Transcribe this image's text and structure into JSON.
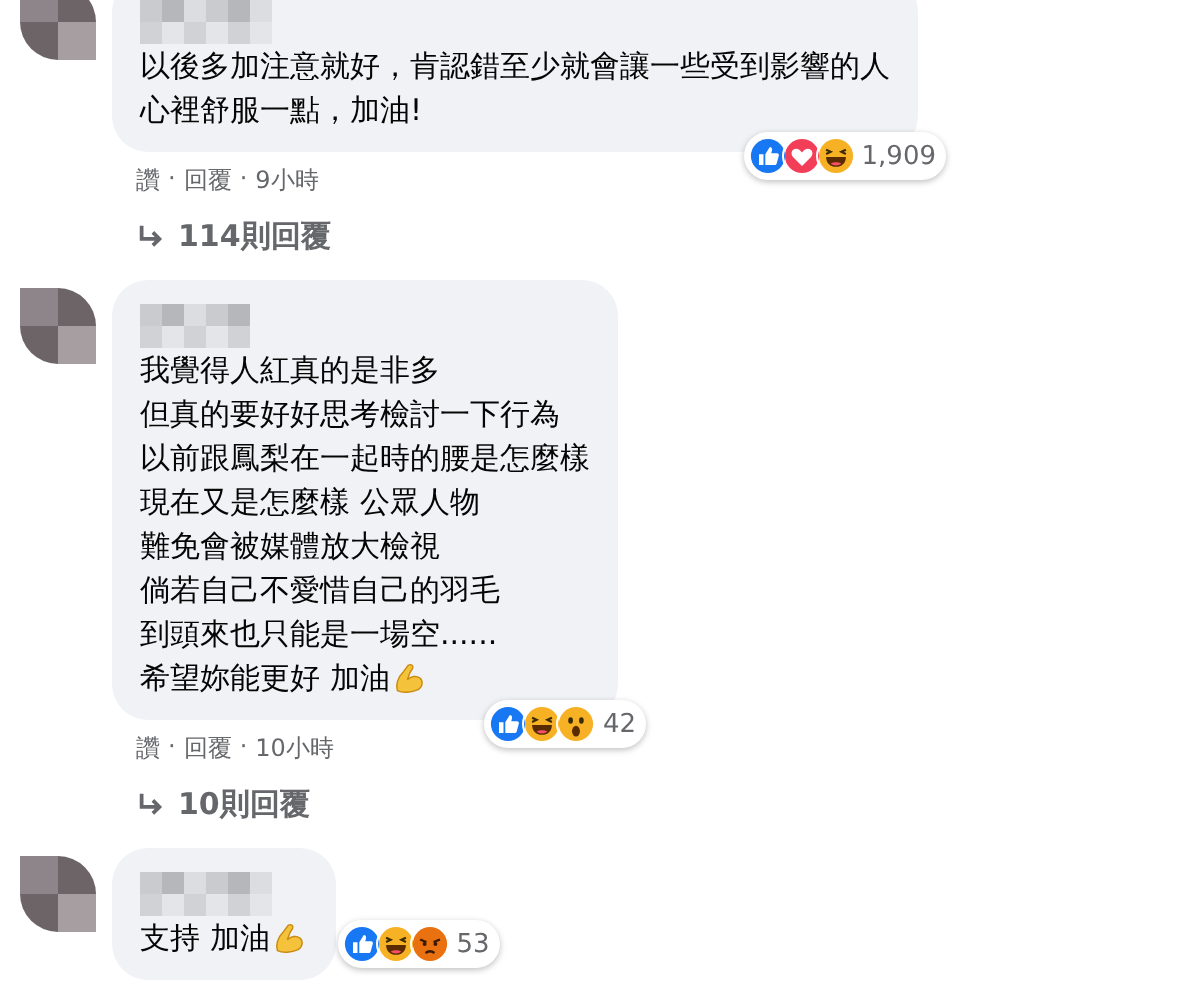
{
  "comments": [
    {
      "lines": [
        "以後多加注意就好，肯認錯至少就會讓一些受到影響的人",
        "心裡舒服一點，加油!"
      ],
      "flex_emoji": false,
      "reactions": [
        {
          "kind": "like"
        },
        {
          "kind": "love"
        },
        {
          "kind": "haha"
        }
      ],
      "reaction_count": "1,909",
      "actions": [
        "讚",
        "回覆",
        "9小時"
      ],
      "replies": "114則回覆"
    },
    {
      "lines": [
        "我覺得人紅真的是非多",
        "但真的要好好思考檢討一下行為",
        "以前跟鳳梨在一起時的腰是怎麼樣",
        "現在又是怎麼樣 公眾人物",
        "難免會被媒體放大檢視",
        "倘若自己不愛惜自己的羽毛",
        "到頭來也只能是一場空......",
        "希望妳能更好 加油"
      ],
      "flex_emoji": true,
      "reactions": [
        {
          "kind": "like"
        },
        {
          "kind": "haha"
        },
        {
          "kind": "wow"
        }
      ],
      "reaction_count": "42",
      "actions": [
        "讚",
        "回覆",
        "10小時"
      ],
      "replies": "10則回覆"
    },
    {
      "lines": [
        "支持 加油"
      ],
      "flex_emoji": true,
      "reactions": [
        {
          "kind": "like"
        },
        {
          "kind": "haha"
        },
        {
          "kind": "angry"
        }
      ],
      "reaction_count": "53"
    }
  ],
  "separator": "·"
}
